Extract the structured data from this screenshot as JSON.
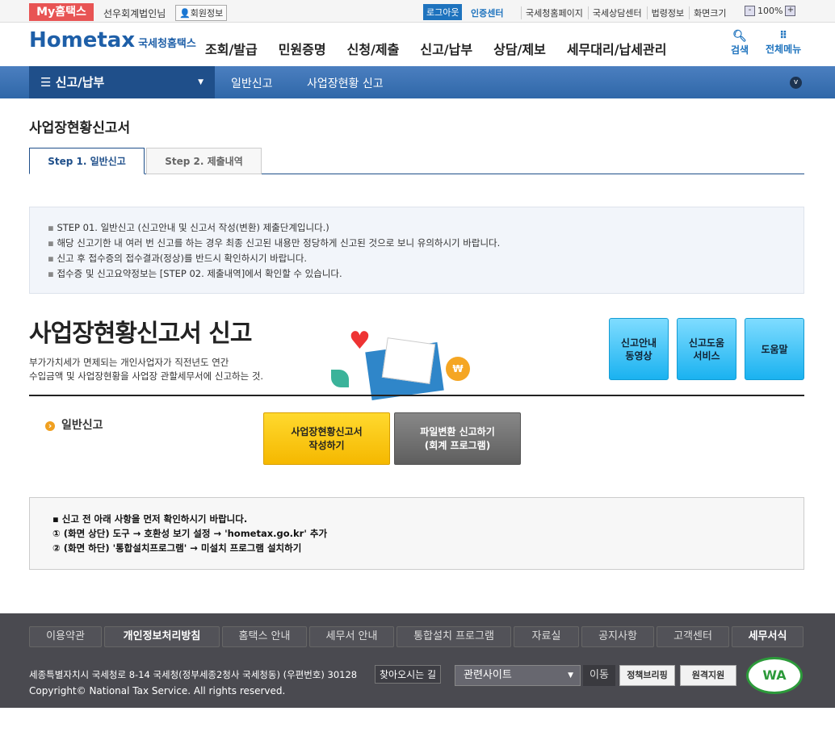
{
  "topbar": {
    "my_hometax": "My홈택스",
    "user": "선우회계법인님",
    "member_info": "회원정보",
    "logout": "로그아웃",
    "cert_center": "인증센터",
    "links": [
      "국세청홈페이지",
      "국세상담센터",
      "법령정보"
    ],
    "screen_size": "화면크기",
    "zoom": "100%",
    "minus": "-",
    "plus": "+"
  },
  "header": {
    "logo": "Hometax",
    "logo_sub": "국세청홈택스",
    "menu": [
      "조회/발급",
      "민원증명",
      "신청/제출",
      "신고/납부",
      "상담/제보",
      "세무대리/납세관리"
    ],
    "search": "검색",
    "all_menu": "전체메뉴"
  },
  "nav": {
    "current": "신고/납부",
    "crumbs": [
      "일반신고",
      "사업장현황 신고"
    ]
  },
  "page": {
    "title": "사업장현황신고서",
    "tabs": [
      "Step 1. 일반신고",
      "Step 2. 제출내역"
    ]
  },
  "info": [
    "STEP 01. 일반신고 (신고안내 및 신고서 작성(변환) 제출단계입니다.)",
    "해당 신고기한 내 여러 번 신고를 하는 경우 최종 신고된 내용만 정당하게 신고된 것으로 보니 유의하시기 바랍니다.",
    "신고 후 접수증의 접수결과(정상)를 반드시 확인하시기 바랍니다.",
    "접수증 및 신고요약정보는 [STEP 02. 제출내역]에서 확인할 수 있습니다."
  ],
  "banner": {
    "title": "사업장현황신고서 신고",
    "desc1": "부가가치세가 면제되는 개인사업자가 직전년도 연간",
    "desc2": "수입금액 및 사업장현황을 사업장 관할세무서에 신고하는 것.",
    "buttons": [
      "신고안내\n동영상",
      "신고도움\n서비스",
      "도움말"
    ]
  },
  "general": {
    "label": "일반신고",
    "write_btn1": "사업장현황신고서",
    "write_btn2": "작성하기",
    "file_btn1": "파일변환 신고하기",
    "file_btn2": "(회계 프로그램)"
  },
  "note": [
    "▪ 신고 전 아래 사항을 먼저 확인하시기 바랍니다.",
    "① (화면 상단)  도구 → 호환성 보기 설정 →  'hometax.go.kr' 추가",
    "② (화면 하단)  '통합설치프로그램'  →  미설치 프로그램 설치하기"
  ],
  "footer": {
    "links": [
      "이용약관",
      "개인정보처리방침",
      "홈택스 안내",
      "세무서 안내",
      "통합설치 프로그램",
      "자료실",
      "공지사항",
      "고객센터",
      "세무서식"
    ],
    "address": "세종특별자치시 국세청로 8-14 국세청(정부세종2청사 국세청동) (우편번호) 30128",
    "find_way": "찾아오시는 길",
    "copyright": "Copyright© National Tax Service. All rights reserved.",
    "related": "관련사이트",
    "go": "이동",
    "policy": "정책브리핑",
    "remote": "원격지원",
    "wa": "WA"
  }
}
